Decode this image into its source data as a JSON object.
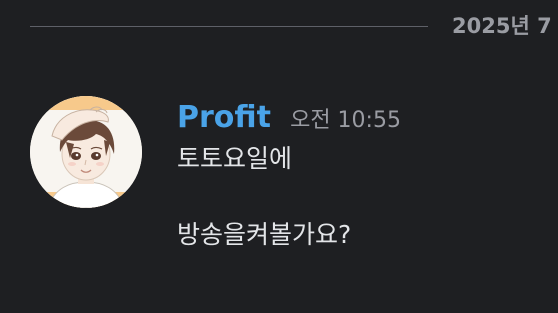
{
  "date_divider": {
    "label": "2025년 7"
  },
  "message": {
    "author": "Profit",
    "timestamp": "오전 10:55",
    "lines": [
      "토토요일에",
      "방송을켜볼가요?"
    ]
  },
  "colors": {
    "background": "#1e1f22",
    "username": "#4aa3e8",
    "timestamp": "#9a9ca3",
    "text": "#e3e5e8",
    "avatar_border": "#f7c98b"
  }
}
